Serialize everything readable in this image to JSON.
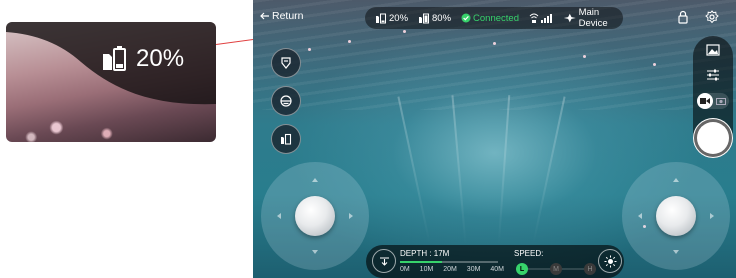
{
  "callout": {
    "battery": "20%"
  },
  "topbar": {
    "return_label": "Return",
    "phone_battery": "20%",
    "device_battery": "80%",
    "connection": "Connected",
    "device": "Main Device"
  },
  "depth": {
    "label": "DEPTH : 17M",
    "ticks": [
      "0M",
      "10M",
      "20M",
      "30M",
      "40M"
    ],
    "value_m": 17,
    "max_m": 40
  },
  "speed": {
    "label": "SPEED:",
    "levels": [
      "L",
      "M",
      "H"
    ],
    "selected": "L"
  },
  "colors": {
    "accent_green": "#37d26b",
    "leader_line": "#e04040"
  }
}
